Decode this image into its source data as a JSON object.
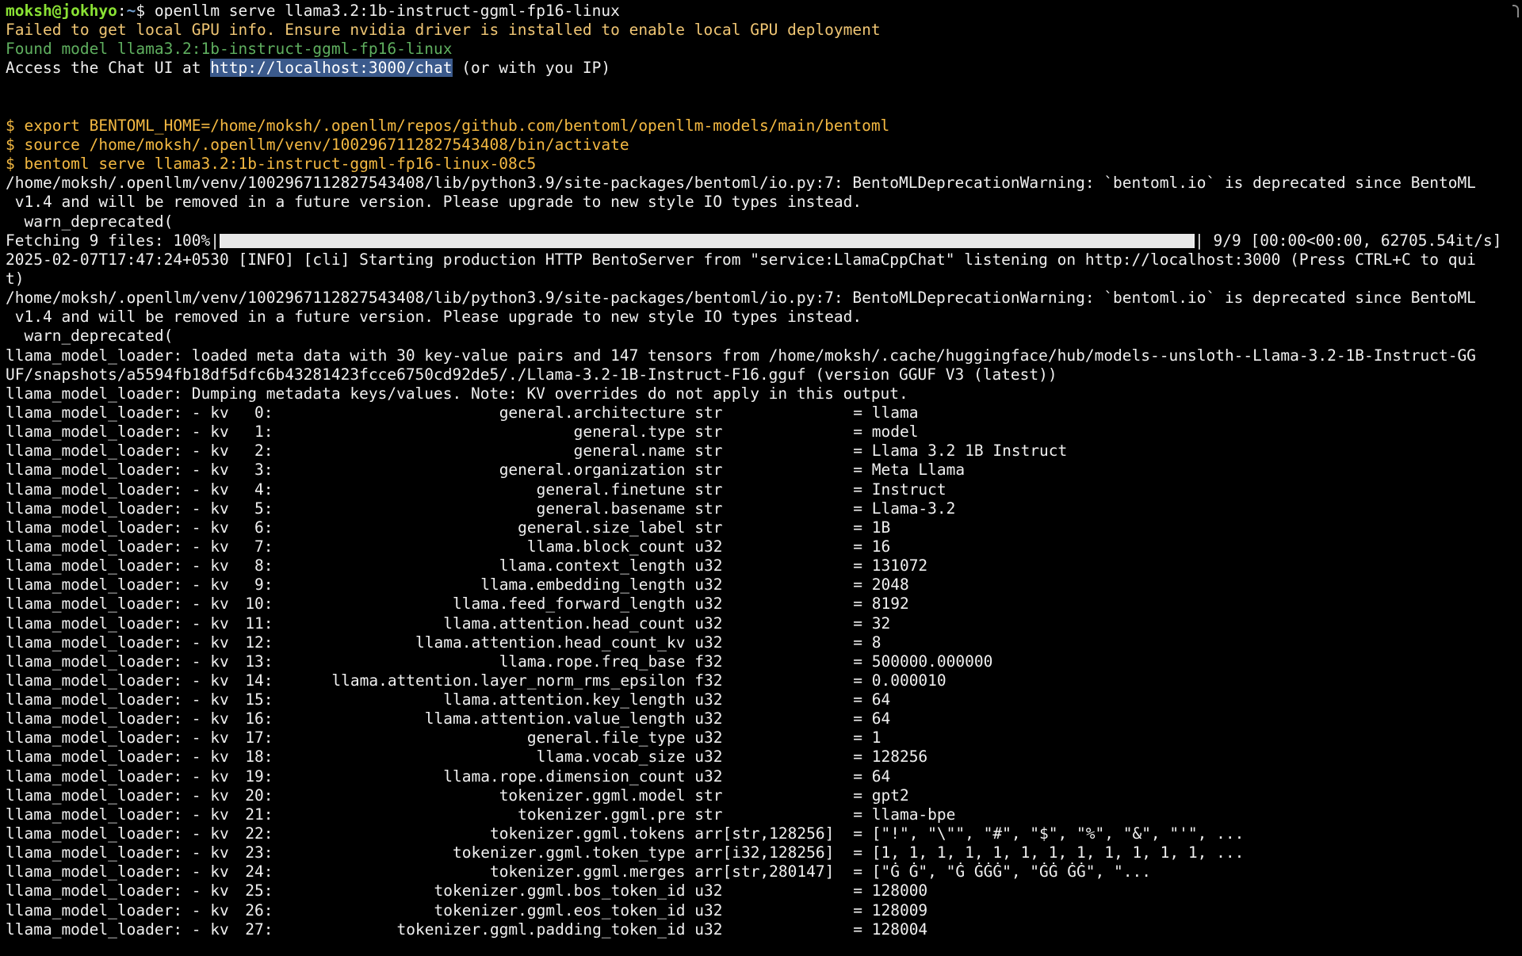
{
  "prompt": {
    "user_host": "moksh@jokhyo",
    "sep": ":",
    "path": "~",
    "symbol": "$",
    "command": "openllm serve llama3.2:1b-instruct-ggml-fp16-linux"
  },
  "messages": {
    "gpu_warning": "Failed to get local GPU info. Ensure nvidia driver is installed to enable local GPU deployment",
    "found_model": "Found model llama3.2:1b-instruct-ggml-fp16-linux",
    "access_prefix": "Access the Chat UI at ",
    "access_link": "http://localhost:3000/chat",
    "access_suffix": " (or with you IP)"
  },
  "commands": [
    "$ export BENTOML_HOME=/home/moksh/.openllm/repos/github.com/bentoml/openllm-models/main/bentoml",
    "$ source /home/moksh/.openllm/venv/100296711282754340​8/bin/activate",
    "$ bentoml serve llama3.2:1b-instruct-ggml-fp16-linux-08c5"
  ],
  "log": {
    "deprecation_1a": "/home/moksh/.openllm/venv/1002967112827543408/lib/python3.9/site-packages/bentoml/io.py:7: BentoMLDeprecationWarning: `bentoml.io` is deprecated since BentoML",
    "deprecation_1b": " v1.4 and will be removed in a future version. Please upgrade to new style IO types instead.",
    "deprecation_1c": "  warn_deprecated(",
    "fetching_prefix": "Fetching 9 files: 100%|",
    "fetching_progress": 1.0,
    "fetching_suffix": "| 9/9 [00:00<00:00, 62705.54it/s]",
    "info_a": "2025-02-07T17:47:24+0530 [INFO] [cli] Starting production HTTP BentoServer from \"service:LlamaCppChat\" listening on http://localhost:3000 (Press CTRL+C to qui",
    "info_b": "t)",
    "deprecation_2a": "/home/moksh/.openllm/venv/1002967112827543408/lib/python3.9/site-packages/bentoml/io.py:7: BentoMLDeprecationWarning: `bentoml.io` is deprecated since BentoML",
    "deprecation_2b": " v1.4 and will be removed in a future version. Please upgrade to new style IO types instead.",
    "deprecation_2c": "  warn_deprecated(",
    "loader_a": "llama_model_loader: loaded meta data with 30 key-value pairs and 147 tensors from /home/moksh/.cache/huggingface/hub/models--unsloth--Llama-3.2-1B-Instruct-GG",
    "loader_b": "UF/snapshots/a5594fb18df5dfc6b43281423fcce6750cd92de5/./Llama-3.2-1B-Instruct-F16.gguf (version GGUF V3 (latest))",
    "loader_c": "llama_model_loader: Dumping metadata keys/values. Note: KV overrides do not apply in this output."
  },
  "kv_prefix": "llama_model_loader: - kv ",
  "kv_rows": [
    {
      "idx": "0:",
      "key": "general.architecture",
      "type": "str",
      "val": "= llama"
    },
    {
      "idx": "1:",
      "key": "general.type",
      "type": "str",
      "val": "= model"
    },
    {
      "idx": "2:",
      "key": "general.name",
      "type": "str",
      "val": "= Llama 3.2 1B Instruct"
    },
    {
      "idx": "3:",
      "key": "general.organization",
      "type": "str",
      "val": "= Meta Llama"
    },
    {
      "idx": "4:",
      "key": "general.finetune",
      "type": "str",
      "val": "= Instruct"
    },
    {
      "idx": "5:",
      "key": "general.basename",
      "type": "str",
      "val": "= Llama-3.2"
    },
    {
      "idx": "6:",
      "key": "general.size_label",
      "type": "str",
      "val": "= 1B"
    },
    {
      "idx": "7:",
      "key": "llama.block_count",
      "type": "u32",
      "val": "= 16"
    },
    {
      "idx": "8:",
      "key": "llama.context_length",
      "type": "u32",
      "val": "= 131072"
    },
    {
      "idx": "9:",
      "key": "llama.embedding_length",
      "type": "u32",
      "val": "= 2048"
    },
    {
      "idx": "10:",
      "key": "llama.feed_forward_length",
      "type": "u32",
      "val": "= 8192"
    },
    {
      "idx": "11:",
      "key": "llama.attention.head_count",
      "type": "u32",
      "val": "= 32"
    },
    {
      "idx": "12:",
      "key": "llama.attention.head_count_kv",
      "type": "u32",
      "val": "= 8"
    },
    {
      "idx": "13:",
      "key": "llama.rope.freq_base",
      "type": "f32",
      "val": "= 500000.000000"
    },
    {
      "idx": "14:",
      "key": "llama.attention.layer_norm_rms_epsilon",
      "type": "f32",
      "val": "= 0.000010"
    },
    {
      "idx": "15:",
      "key": "llama.attention.key_length",
      "type": "u32",
      "val": "= 64"
    },
    {
      "idx": "16:",
      "key": "llama.attention.value_length",
      "type": "u32",
      "val": "= 64"
    },
    {
      "idx": "17:",
      "key": "general.file_type",
      "type": "u32",
      "val": "= 1"
    },
    {
      "idx": "18:",
      "key": "llama.vocab_size",
      "type": "u32",
      "val": "= 128256"
    },
    {
      "idx": "19:",
      "key": "llama.rope.dimension_count",
      "type": "u32",
      "val": "= 64"
    },
    {
      "idx": "20:",
      "key": "tokenizer.ggml.model",
      "type": "str",
      "val": "= gpt2"
    },
    {
      "idx": "21:",
      "key": "tokenizer.ggml.pre",
      "type": "str",
      "val": "= llama-bpe"
    },
    {
      "idx": "22:",
      "key": "tokenizer.ggml.tokens",
      "type": "arr[str,128256]",
      "val": "= [\"!\", \"\\\"\", \"#\", \"$\", \"%\", \"&\", \"'\", ..."
    },
    {
      "idx": "23:",
      "key": "tokenizer.ggml.token_type",
      "type": "arr[i32,128256]",
      "val": "= [1, 1, 1, 1, 1, 1, 1, 1, 1, 1, 1, 1, ..."
    },
    {
      "idx": "24:",
      "key": "tokenizer.ggml.merges",
      "type": "arr[str,280147]",
      "val": "= [\"Ġ Ġ\", \"Ġ ĠĠĠ\", \"ĠĠ ĠĠ\", \"..."
    },
    {
      "idx": "25:",
      "key": "tokenizer.ggml.bos_token_id",
      "type": "u32",
      "val": "= 128000"
    },
    {
      "idx": "26:",
      "key": "tokenizer.ggml.eos_token_id",
      "type": "u32",
      "val": "= 128009"
    },
    {
      "idx": "27:",
      "key": "tokenizer.ggml.padding_token_id",
      "type": "u32",
      "val": "= 128004"
    }
  ],
  "colors": {
    "background": "#000000",
    "foreground": "#f0f0f0",
    "warning": "#f0c674",
    "found": "#5faf5f",
    "command": "#f4b942",
    "link_highlight": "#3b5a8c"
  }
}
